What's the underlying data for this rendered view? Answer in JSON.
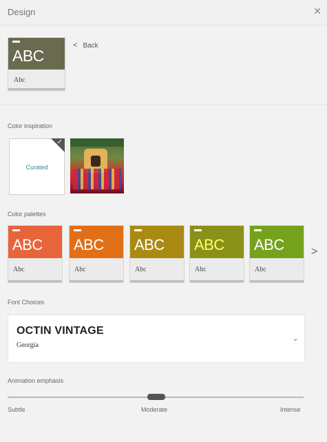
{
  "window": {
    "title": "Design",
    "close_glyph": "✕"
  },
  "selected_theme": {
    "sample_title": "ABC",
    "sample_sub": "Abc",
    "color": "#6a6a51"
  },
  "nav": {
    "back_label": "Back",
    "back_icon": "chevron-left-icon"
  },
  "color_inspiration": {
    "label": "Color inspiration",
    "options": [
      {
        "label": "Curated",
        "selected": true
      },
      {
        "label": "",
        "kind": "photo"
      }
    ]
  },
  "color_palettes": {
    "label": "Color palettes",
    "items": [
      {
        "title": "ABC",
        "sub": "Abc",
        "color": "#e8643a",
        "accent": "#ffffff"
      },
      {
        "title": "ABC",
        "sub": "Abc",
        "color": "#e16f18",
        "accent": "#ffffff"
      },
      {
        "title": "ABC",
        "sub": "Abc",
        "color": "#ab8a12",
        "accent": "#ffffff"
      },
      {
        "title": "ABC",
        "sub": "Abc",
        "color": "#8a9118",
        "accent": "#ffff66"
      },
      {
        "title": "ABC",
        "sub": "Abc",
        "color": "#76a11d",
        "accent": "#ffffff"
      }
    ],
    "next_icon": "chevron-right-icon"
  },
  "font_choices": {
    "label": "Font Choices",
    "selected_heading": "OCTIN VINTAGE",
    "selected_body": "Georgia"
  },
  "animation": {
    "label": "Animation emphasis",
    "options": [
      "Subtle",
      "Moderate",
      "Intense"
    ],
    "value": "Moderate"
  }
}
